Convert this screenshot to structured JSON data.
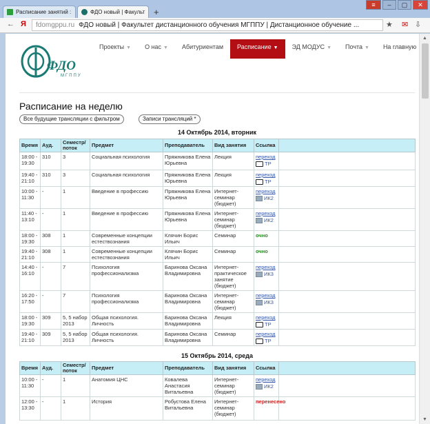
{
  "browser": {
    "tabs": [
      {
        "label": "Расписание занятий :"
      },
      {
        "label": "ФДО новый | Факульт"
      }
    ],
    "url_domain": "fdomgppu.ru",
    "url_title": "ФДО новый | Факультет дистанционного обучения МГППУ | Дистанционное обучение ..."
  },
  "site": {
    "logo_text": "ФДО",
    "logo_sub": "МГППУ",
    "nav": [
      {
        "label": "Проекты"
      },
      {
        "label": "О нас"
      },
      {
        "label": "Абитуриентам"
      },
      {
        "label": "Расписание"
      },
      {
        "label": "ЭД МОДУС"
      },
      {
        "label": "Почта"
      },
      {
        "label": "На главную"
      }
    ]
  },
  "page": {
    "title": "Расписание на неделю",
    "filter_button": "Все будущие трансляции с фильтром",
    "records_button": "Записи трансляций *"
  },
  "columns": [
    "Время",
    "Ауд.",
    "Семестр/ поток",
    "Предмет",
    "Преподаватель",
    "Вид занятия",
    "Ссылка"
  ],
  "days": [
    {
      "title": "14 Октябрь 2014, вторник",
      "rows": [
        {
          "time": "18:00 - 19:30",
          "room": "310",
          "sem": "3",
          "subject": "Социальная психология",
          "teacher": "Пряжникова Елена Юрьевна",
          "type": "Лекция",
          "link": "переход",
          "tag": "ТР",
          "icon": "tv-icon"
        },
        {
          "time": "19:40 - 21:10",
          "room": "310",
          "sem": "3",
          "subject": "Социальная психология",
          "teacher": "Пряжникова Елена Юрьевна",
          "type": "Лекция",
          "link": "переход",
          "tag": "ТР",
          "icon": "tv-icon"
        },
        {
          "time": "10:00 - 11:30",
          "room": "-",
          "sem": "1",
          "subject": "Введение в профессию",
          "teacher": "Пряжникова Елена Юрьевна",
          "type": "Интернет-семинар (бюджет)",
          "link": "переход",
          "tag": "ИК2",
          "icon": "image-icon"
        },
        {
          "time": "11:40 - 13:10",
          "room": "-",
          "sem": "1",
          "subject": "Введение в профессию",
          "teacher": "Пряжникова Елена Юрьевна",
          "type": "Интернет-семинар (бюджет)",
          "link": "переход",
          "tag": "ИК2",
          "icon": "image-icon"
        },
        {
          "time": "18:00 - 19:30",
          "room": "308",
          "sem": "1",
          "subject": "Современные концепции естествознания",
          "teacher": "Клячин Борис Ильич",
          "type": "Семинар",
          "status": "очно"
        },
        {
          "time": "19:40 - 21:10",
          "room": "308",
          "sem": "1",
          "subject": "Современные концепции естествознания",
          "teacher": "Клячин Борис Ильич",
          "type": "Семинар",
          "status": "очно"
        },
        {
          "time": "14:40 - 16:10",
          "room": "-",
          "sem": "7",
          "subject": "Психология профессионализма",
          "teacher": "Баринова Оксана Владимировна",
          "type": "Интернет-практическое занятие (бюджет)",
          "link": "переход",
          "tag": "ИК3",
          "icon": "image-icon"
        },
        {
          "time": "16:20 - 17:50",
          "room": "-",
          "sem": "7",
          "subject": "Психология профессионализма",
          "teacher": "Баринова Оксана Владимировна",
          "type": "Интернет-семинар (бюджет)",
          "link": "переход",
          "tag": "ИК3",
          "icon": "image-icon"
        },
        {
          "time": "18:00 - 19:30",
          "room": "309",
          "sem": "5, 5 набор 2013",
          "subject": "Общая психология. Личность",
          "teacher": "Баринова Оксана Владимировна",
          "type": "Лекция",
          "link": "переход",
          "tag": "ТР",
          "icon": "tv-icon"
        },
        {
          "time": "19:40 - 21:10",
          "room": "309",
          "sem": "5, 5 набор 2013",
          "subject": "Общая психология. Личность",
          "teacher": "Баринова Оксана Владимировна",
          "type": "Семинар",
          "link": "переход",
          "tag": "ТР",
          "icon": "tv-icon"
        }
      ]
    },
    {
      "title": "15 Октябрь 2014, среда",
      "rows": [
        {
          "time": "10:00 - 11:30",
          "room": "-",
          "sem": "1",
          "subject": "Анатомия ЦНС",
          "teacher": "Ковалева Анастасия Витальевна",
          "type": "Интернет-семинар (бюджет)",
          "link": "переход",
          "tag": "ИК2",
          "icon": "image-icon"
        },
        {
          "time": "12:00 - 13:30",
          "room": "-",
          "sem": "1",
          "subject": "История",
          "teacher": "Робустова Елена Витальевна",
          "type": "Интернет-семинар (бюджет)",
          "status": "перенесено"
        }
      ]
    }
  ]
}
